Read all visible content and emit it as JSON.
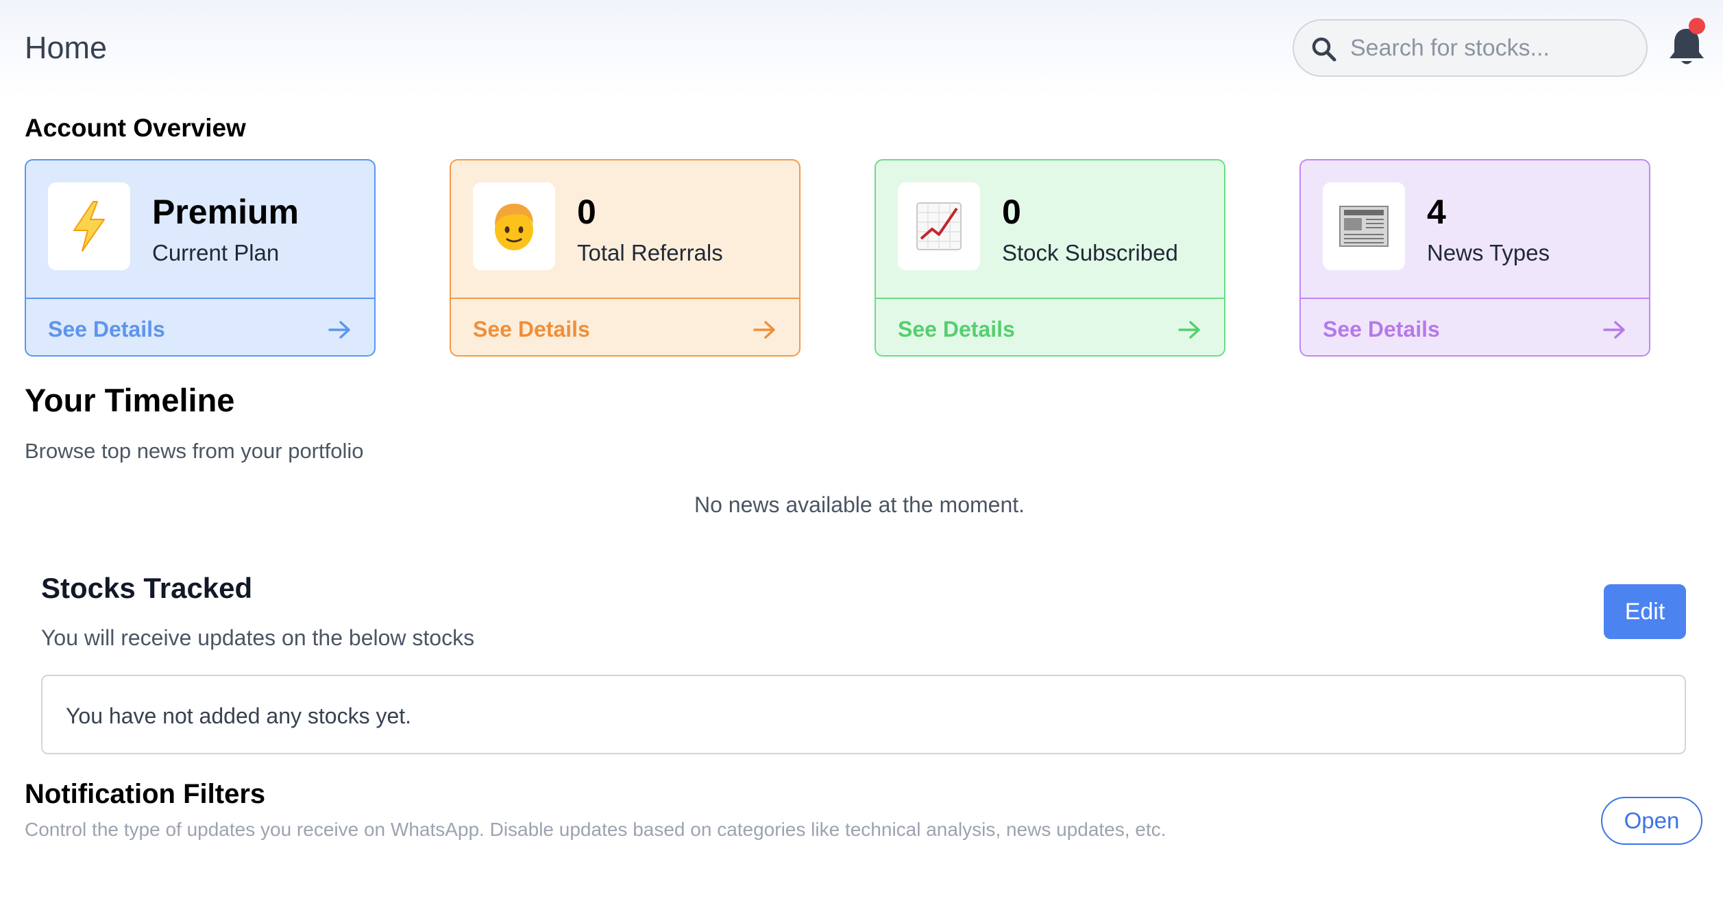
{
  "header": {
    "title": "Home",
    "search_placeholder": "Search for stocks...",
    "search_icon": "search-icon",
    "notification_icon": "bell-icon"
  },
  "account_overview": {
    "heading": "Account Overview",
    "cards": [
      {
        "value": "Premium",
        "label": "Current Plan",
        "icon": "lightning-icon",
        "link": "See Details",
        "color": "#5a95f2"
      },
      {
        "value": "0",
        "label": "Total Referrals",
        "icon": "person-icon",
        "link": "See Details",
        "color": "#f39a4a"
      },
      {
        "value": "0",
        "label": "Stock Subscribed",
        "icon": "chart-up-icon",
        "link": "See Details",
        "color": "#6bdc83"
      },
      {
        "value": "4",
        "label": "News Types",
        "icon": "newspaper-icon",
        "link": "See Details",
        "color": "#c087f2"
      }
    ]
  },
  "timeline": {
    "heading": "Your Timeline",
    "subheading": "Browse top news from your portfolio",
    "empty_message": "No news available at the moment."
  },
  "stocks_tracked": {
    "heading": "Stocks Tracked",
    "subheading": "You will receive updates on the below stocks",
    "edit_label": "Edit",
    "empty_message": "You have not added any stocks yet."
  },
  "notification_filters": {
    "heading": "Notification Filters",
    "description": "Control the type of updates you receive on WhatsApp. Disable updates based on categories like technical analysis, news updates, etc.",
    "open_label": "Open"
  }
}
